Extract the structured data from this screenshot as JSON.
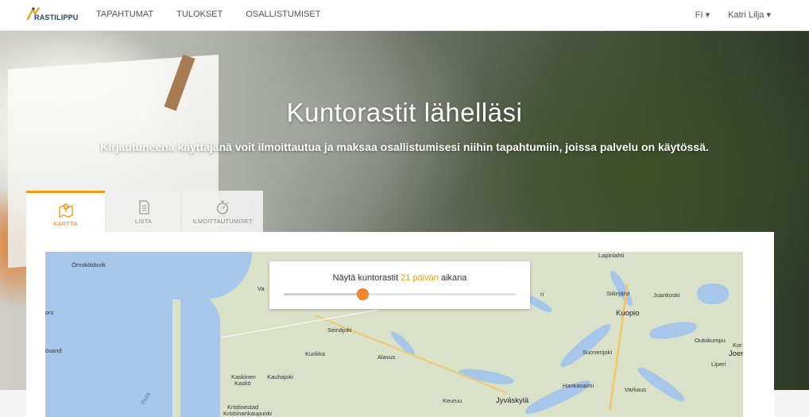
{
  "brand": {
    "name": "RASTILIPPU",
    "color_dark": "#2a3e63",
    "color_accent": "#f39c12"
  },
  "nav": {
    "links": [
      "TAPAHTUMAT",
      "TULOKSET",
      "OSALLISTUMISET"
    ],
    "language": "FI ▾",
    "user": "Katri Lilja ▾"
  },
  "hero": {
    "title": "Kuntorastit lähelläsi",
    "subtitle": "Kirjautuneena käyttäjänä voit ilmoittautua ja maksaa osallistumisesi niihin tapahtumiin, joissa palvelu on käytössä."
  },
  "tabs": [
    {
      "label": "KARTTA",
      "icon": "map-icon",
      "active": true
    },
    {
      "label": "LISTA",
      "icon": "list-icon",
      "active": false
    },
    {
      "label": "ILMOITTAUTUMISET",
      "icon": "stopwatch-icon",
      "active": false
    }
  ],
  "slider": {
    "prefix": "Näytä kuntorastit ",
    "days": "21 päivän",
    "suffix": " aikana",
    "level": 0.34
  },
  "map": {
    "cities": [
      "Örnsköldsvik",
      "Va",
      "ors",
      "ösand",
      "Seinäjoki",
      "Kurikka",
      "Alavus",
      "Kaskinen",
      "Kaskö",
      "Kauhajoki",
      "Kristinestad",
      "Kristiinankaupunki",
      "Keuruu",
      "Jyväskylä",
      "Hankasalmi",
      "Varkaus",
      "Suonenjoki",
      "Kuopio",
      "Siilinjärvi",
      "Juankoski",
      "Lapinlahti",
      "Outokumpu",
      "Kor",
      "Joer",
      "Liperi",
      "thula",
      "ri"
    ]
  }
}
